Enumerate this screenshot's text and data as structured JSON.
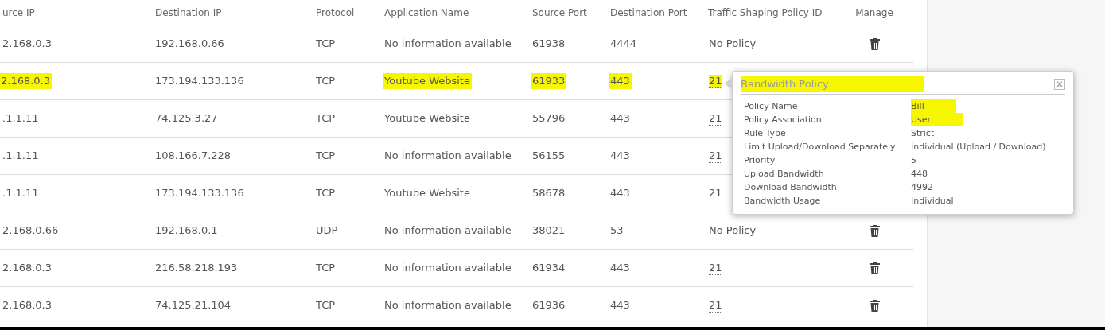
{
  "table": {
    "columns": [
      "urce IP",
      "Destination IP",
      "Protocol",
      "Application Name",
      "Source Port",
      "Destination Port",
      "Traffic Shaping Policy ID",
      "Manage"
    ],
    "rows": [
      {
        "source_ip": "2.168.0.3",
        "destination_ip": "192.168.0.66",
        "protocol": "TCP",
        "application": "No information available",
        "source_port": "61938",
        "destination_port": "4444",
        "policy": "No Policy",
        "policy_link": false,
        "delete_visible": true,
        "highlighted": false
      },
      {
        "source_ip": "2.168.0.3",
        "destination_ip": "173.194.133.136",
        "protocol": "TCP",
        "application": "Youtube Website",
        "source_port": "61933",
        "destination_port": "443",
        "policy": "21",
        "policy_link": true,
        "delete_visible": false,
        "highlighted": true
      },
      {
        "source_ip": ".1.1.11",
        "destination_ip": "74.125.3.27",
        "protocol": "TCP",
        "application": "Youtube Website",
        "source_port": "55796",
        "destination_port": "443",
        "policy": "21",
        "policy_link": true,
        "delete_visible": false,
        "highlighted": false
      },
      {
        "source_ip": ".1.1.11",
        "destination_ip": "108.166.7.228",
        "protocol": "TCP",
        "application": "No information available",
        "source_port": "56155",
        "destination_port": "443",
        "policy": "21",
        "policy_link": true,
        "delete_visible": false,
        "highlighted": false
      },
      {
        "source_ip": ".1.1.11",
        "destination_ip": "173.194.133.136",
        "protocol": "TCP",
        "application": "Youtube Website",
        "source_port": "58678",
        "destination_port": "443",
        "policy": "21",
        "policy_link": true,
        "delete_visible": false,
        "highlighted": false
      },
      {
        "source_ip": "2.168.0.66",
        "destination_ip": "192.168.0.1",
        "protocol": "UDP",
        "application": "No information available",
        "source_port": "38021",
        "destination_port": "53",
        "policy": "No Policy",
        "policy_link": false,
        "delete_visible": true,
        "highlighted": false
      },
      {
        "source_ip": "2.168.0.3",
        "destination_ip": "216.58.218.193",
        "protocol": "TCP",
        "application": "No information available",
        "source_port": "61934",
        "destination_port": "443",
        "policy": "21",
        "policy_link": true,
        "delete_visible": true,
        "highlighted": false
      },
      {
        "source_ip": "2.168.0.3",
        "destination_ip": "74.125.21.104",
        "protocol": "TCP",
        "application": "No information available",
        "source_port": "61936",
        "destination_port": "443",
        "policy": "21",
        "policy_link": true,
        "delete_visible": true,
        "highlighted": false
      }
    ]
  },
  "popover": {
    "title": "Bandwidth Policy",
    "title_highlighted": true,
    "fields": [
      {
        "label": "Policy Name",
        "value": "Bill",
        "highlighted": true
      },
      {
        "label": "Policy Association",
        "value": "User",
        "highlighted": true
      },
      {
        "label": "Rule Type",
        "value": "Strict",
        "highlighted": false
      },
      {
        "label": "Limit Upload/Download Separately",
        "value": "Individual (Upload / Download)",
        "highlighted": false
      },
      {
        "label": "Priority",
        "value": "5",
        "highlighted": false
      },
      {
        "label": "Upload Bandwidth",
        "value": "448",
        "highlighted": false
      },
      {
        "label": "Download Bandwidth",
        "value": "4992",
        "highlighted": false
      },
      {
        "label": "Bandwidth Usage",
        "value": "Individual",
        "highlighted": false
      }
    ]
  }
}
